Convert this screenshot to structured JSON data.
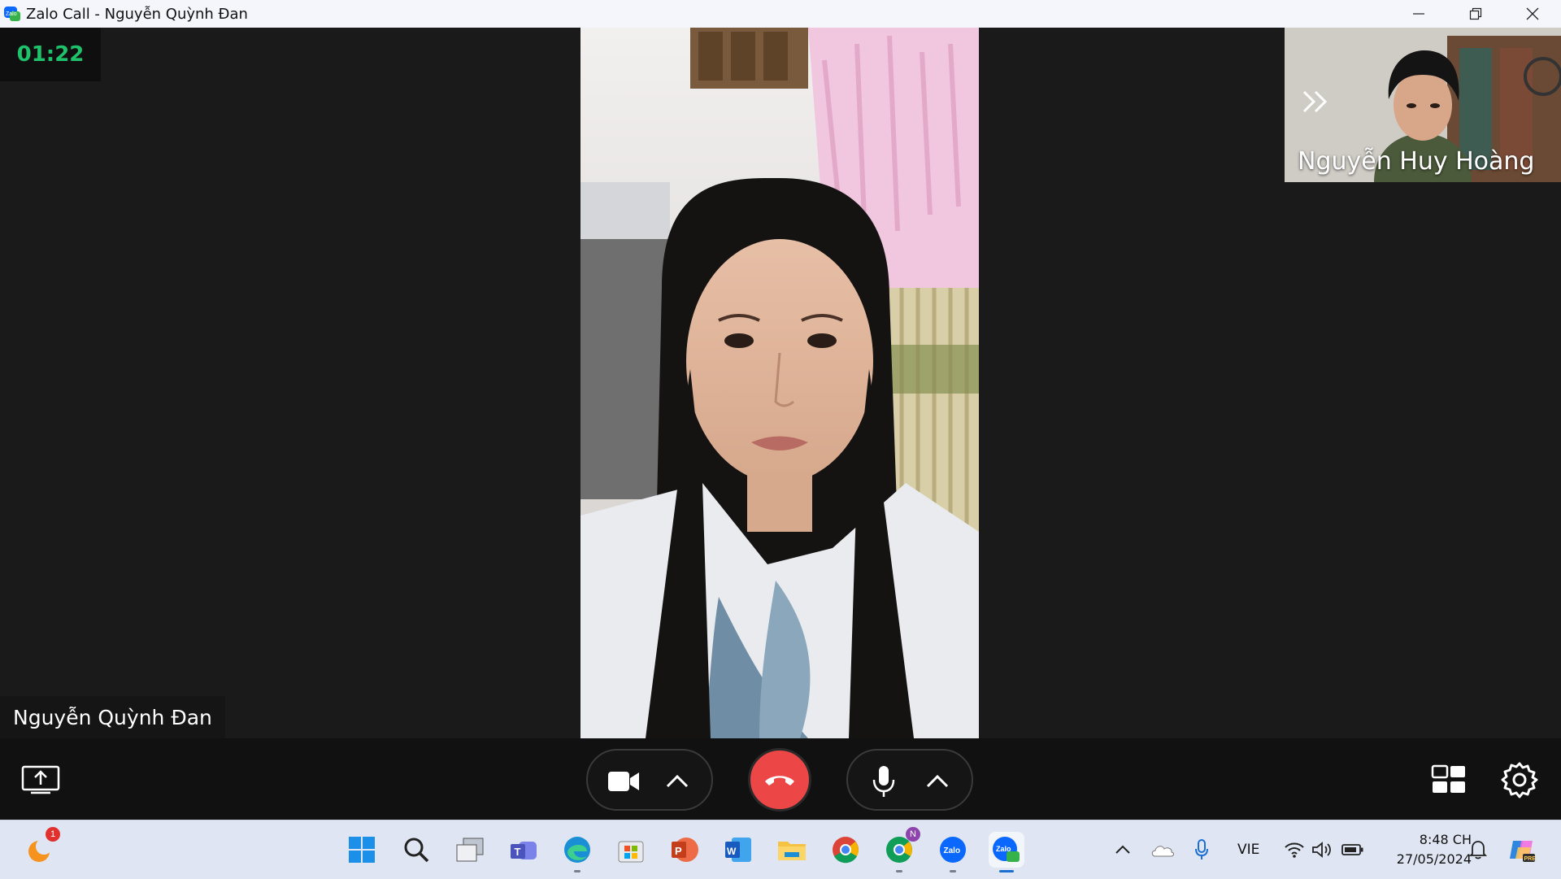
{
  "window": {
    "title": "Zalo Call - Nguyễn Quỳnh Đan"
  },
  "call": {
    "timer": "01:22",
    "remote_name": "Nguyễn Quỳnh Đan",
    "self_name": "Nguyễn Huy Hoàng",
    "end_color": "#ec4646",
    "timer_color": "#1ec26b"
  },
  "controls": {
    "icons": [
      "share-screen-icon",
      "camera-icon",
      "chevron-up-icon",
      "end-call-icon",
      "microphone-icon",
      "chevron-up-icon",
      "layout-grid-icon",
      "gear-icon"
    ]
  },
  "taskbar": {
    "notification_badge": "1",
    "app_badge": "N",
    "apps": [
      "start",
      "search",
      "task-view",
      "teams",
      "edge",
      "store",
      "powerpoint",
      "word",
      "file-explorer",
      "chrome",
      "chrome-profile",
      "zalo",
      "zalo-call"
    ],
    "tray": {
      "language": "VIE",
      "time": "8:48 CH",
      "date": "27/05/2024"
    }
  }
}
